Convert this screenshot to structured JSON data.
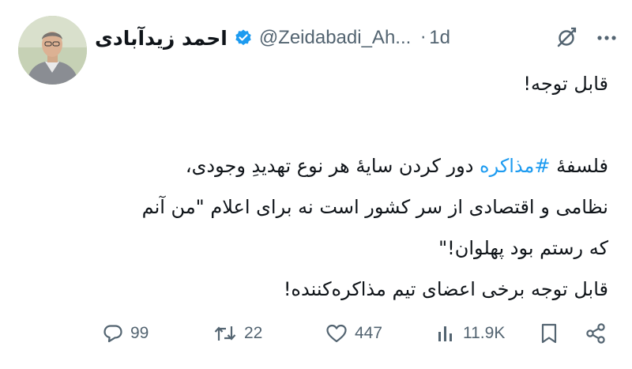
{
  "author": {
    "name": "احمد زیدآبادی",
    "handle": "@Zeidabadi_Ah...",
    "dot": "·",
    "time": "1d",
    "avatar_icon": "avatar-photo",
    "verified_color": "#1d9bf0"
  },
  "tweet": {
    "line1": "قابل توجه!",
    "line2_prefix": "فلسفهٔ ",
    "hashtag": "#مذاکره",
    "line2_suffix": " دور کردن سایهٔ هر نوع تهدیدِ وجودی،",
    "line3": "نظامی و اقتصادی از سر کشور است نه برای اعلام \"من آنم",
    "line4": "که رستم بود پهلوان!\"",
    "line5": "قابل توجه برخی اعضای تیم مذاکره‌کننده!",
    "hashtag_color": "#1d9bf0"
  },
  "actions": {
    "replies": "99",
    "retweets": "22",
    "likes": "447",
    "views": "11.9K"
  },
  "icons": {
    "reply": "reply-icon",
    "retweet": "retweet-icon",
    "like": "heart-icon",
    "views": "views-icon",
    "bookmark": "bookmark-icon",
    "share": "share-icon",
    "grok": "grok-icon",
    "more": "more-icon"
  },
  "colors": {
    "text": "#0f1419",
    "muted": "#536471",
    "accent": "#1d9bf0"
  }
}
